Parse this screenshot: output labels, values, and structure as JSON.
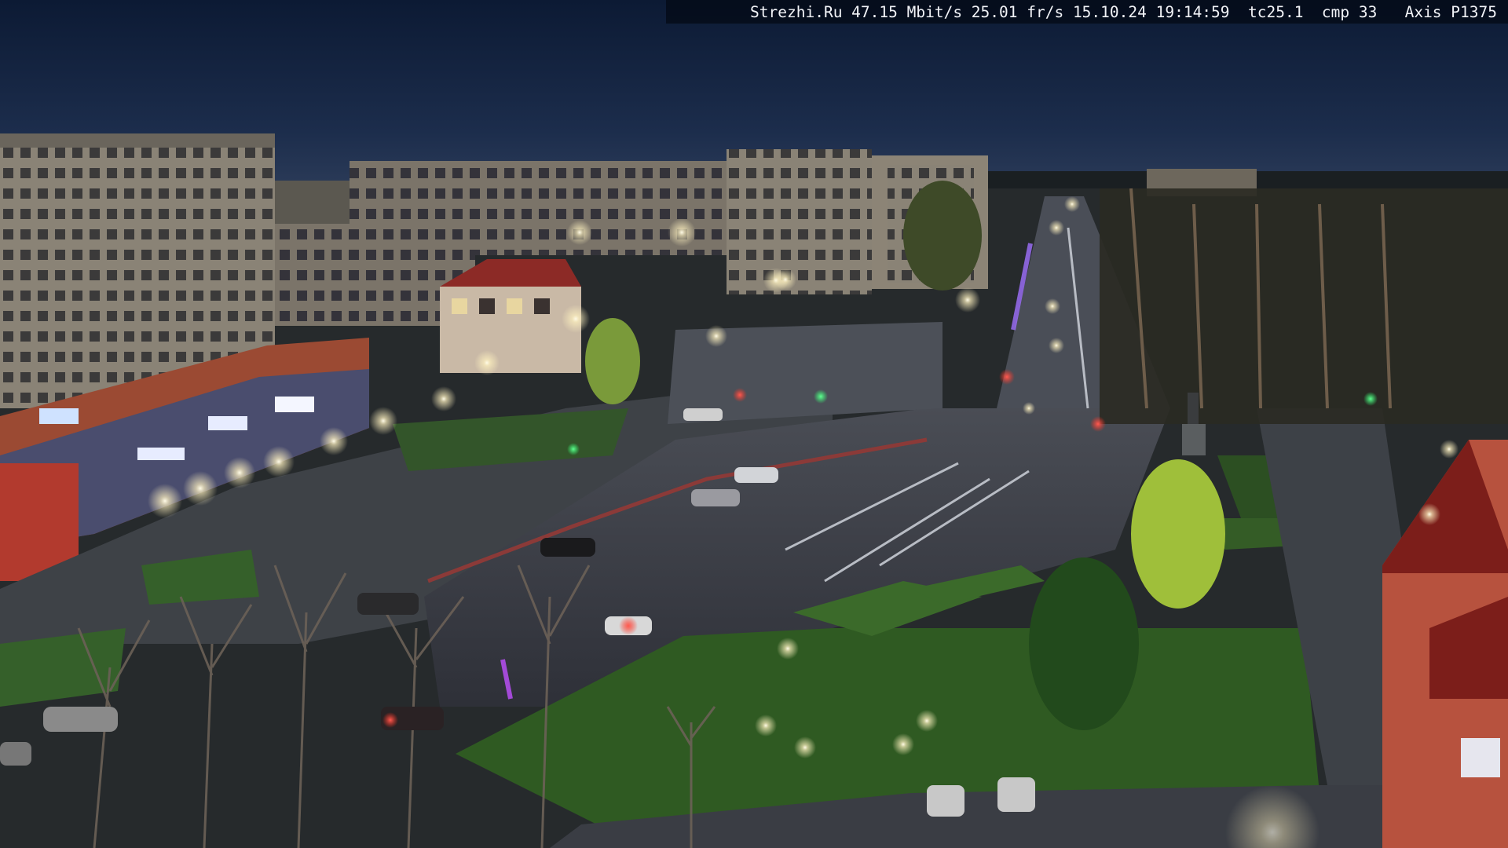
{
  "camera_overlay": {
    "text": "Strezhi.Ru 47.15 Mbit/s 25.01 fr/s 15.10.24 19:14:59  tc25.1  cmp 33   Axis P1375"
  },
  "scene": {
    "description_icon": "night-city-street-scene",
    "colors": {
      "sky_top": "#0e1d3a",
      "sky_horizon": "#2a3b5a",
      "asphalt": "#3a3d45",
      "grass": "#2f5a22",
      "building_panel": "#8b8478",
      "building_red": "#a0402e",
      "lamp_glow": "#fff6d8",
      "tree_bare": "#5b5246"
    }
  }
}
